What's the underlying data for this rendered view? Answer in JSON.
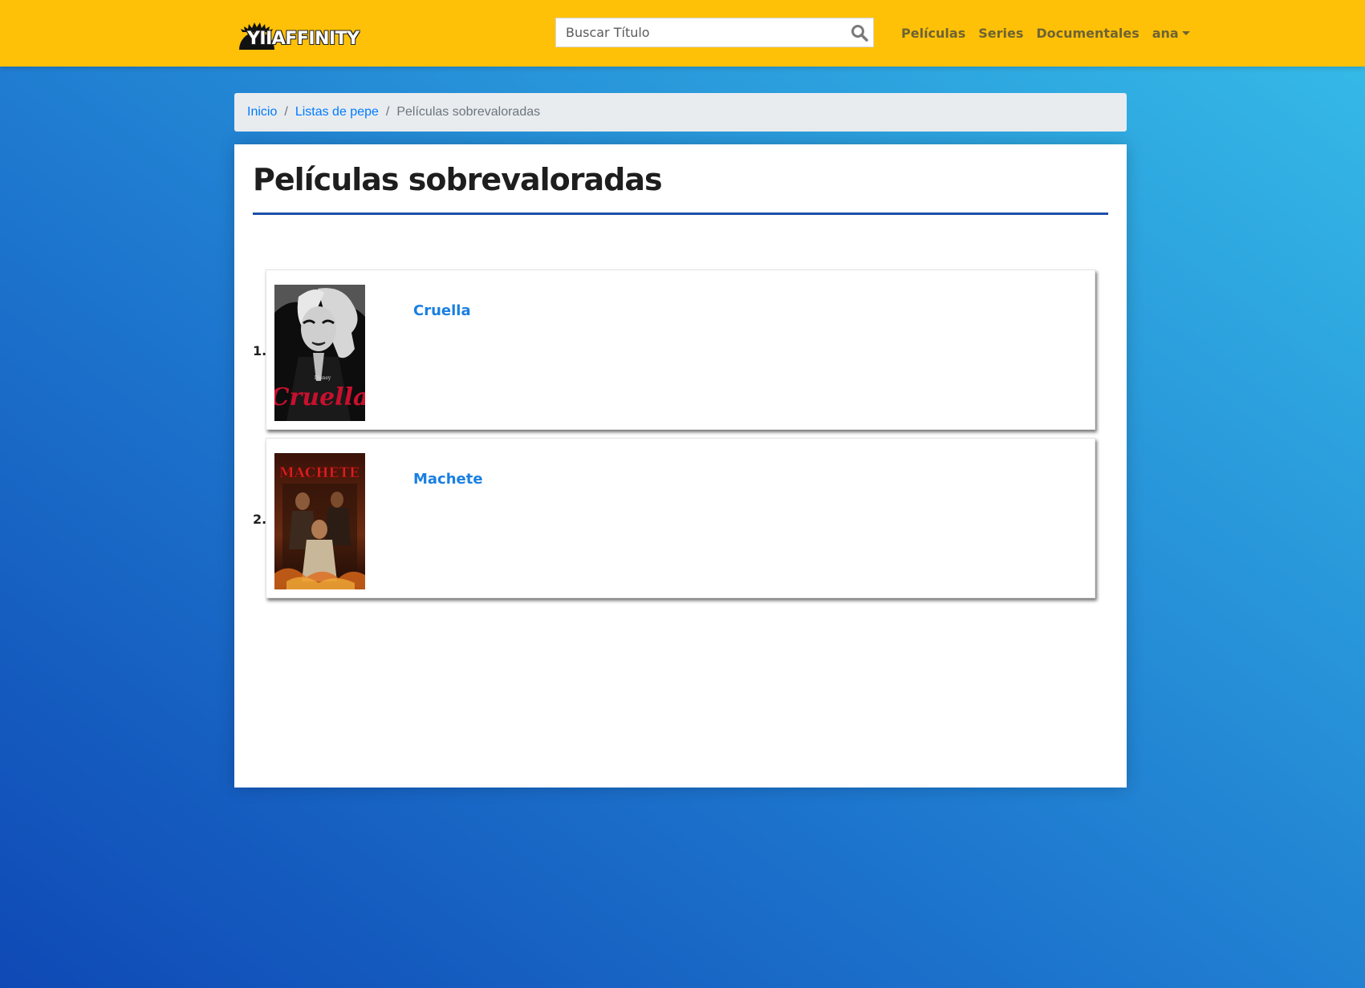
{
  "header": {
    "brand": "YIIAFFINITY",
    "search": {
      "placeholder": "Buscar Título",
      "value": ""
    },
    "nav": [
      "Películas",
      "Series",
      "Documentales"
    ],
    "user": "ana"
  },
  "breadcrumb": {
    "items": [
      "Inicio",
      "Listas de pepe"
    ],
    "current": "Películas sobrevaloradas"
  },
  "page": {
    "title": "Películas sobrevaloradas"
  },
  "movies": [
    {
      "rank": "1.",
      "title": "Cruella",
      "poster_text": "Cruella",
      "poster_brand": "Disney"
    },
    {
      "rank": "2.",
      "title": "Machete",
      "poster_text": "MACHETE"
    }
  ],
  "colors": {
    "navbar": "#fec108",
    "link": "#007bff",
    "title_rule": "#1d4fa8"
  }
}
